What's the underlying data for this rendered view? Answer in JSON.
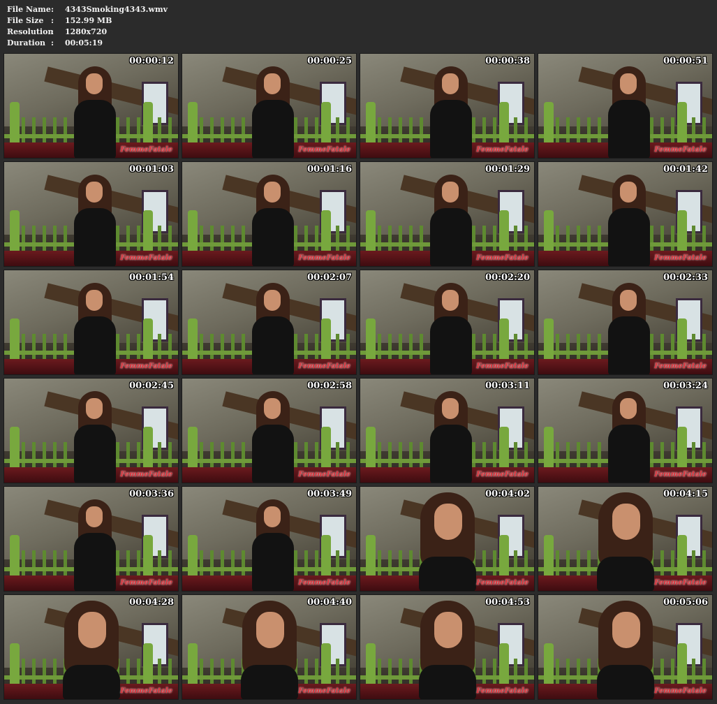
{
  "file_info": {
    "rows": [
      {
        "key": "File Name",
        "sep": ":",
        "value": "4343Smoking4343.wmv"
      },
      {
        "key": "File Size",
        "sep": ":",
        "value": "152.99 MB"
      },
      {
        "key": "Resolution",
        "sep": ":",
        "value": "1280x720"
      },
      {
        "key": "Duration",
        "sep": ":",
        "value": "00:05:19"
      }
    ]
  },
  "thumbnails": [
    {
      "timestamp": "00:00:12",
      "logo": "FemmeFatale",
      "style": "wide"
    },
    {
      "timestamp": "00:00:25",
      "logo": "FemmeFatale",
      "style": "wide"
    },
    {
      "timestamp": "00:00:38",
      "logo": "FemmeFatale",
      "style": "wide"
    },
    {
      "timestamp": "00:00:51",
      "logo": "FemmeFatale",
      "style": "wide"
    },
    {
      "timestamp": "00:01:03",
      "logo": "FemmeFatale",
      "style": "wide"
    },
    {
      "timestamp": "00:01:16",
      "logo": "FemmeFatale",
      "style": "wide"
    },
    {
      "timestamp": "00:01:29",
      "logo": "FemmeFatale",
      "style": "wide"
    },
    {
      "timestamp": "00:01:42",
      "logo": "FemmeFatale",
      "style": "wide"
    },
    {
      "timestamp": "00:01:54",
      "logo": "FemmeFatale",
      "style": "wide"
    },
    {
      "timestamp": "00:02:07",
      "logo": "FemmeFatale",
      "style": "wide"
    },
    {
      "timestamp": "00:02:20",
      "logo": "FemmeFatale",
      "style": "wide"
    },
    {
      "timestamp": "00:02:33",
      "logo": "FemmeFatale",
      "style": "wide"
    },
    {
      "timestamp": "00:02:45",
      "logo": "FemmeFatale",
      "style": "wide"
    },
    {
      "timestamp": "00:02:58",
      "logo": "FemmeFatale",
      "style": "wide"
    },
    {
      "timestamp": "00:03:11",
      "logo": "FemmeFatale",
      "style": "wide"
    },
    {
      "timestamp": "00:03:24",
      "logo": "FemmeFatale",
      "style": "wide"
    },
    {
      "timestamp": "00:03:36",
      "logo": "FemmeFatale",
      "style": "wide"
    },
    {
      "timestamp": "00:03:49",
      "logo": "FemmeFatale",
      "style": "wide"
    },
    {
      "timestamp": "00:04:02",
      "logo": "FemmeFatale",
      "style": "closeup"
    },
    {
      "timestamp": "00:04:15",
      "logo": "FemmeFatale",
      "style": "closeup"
    },
    {
      "timestamp": "00:04:28",
      "logo": "FemmeFatale",
      "style": "closeup"
    },
    {
      "timestamp": "00:04:40",
      "logo": "FemmeFatale",
      "style": "closeup"
    },
    {
      "timestamp": "00:04:53",
      "logo": "FemmeFatale",
      "style": "closeup"
    },
    {
      "timestamp": "00:05:06",
      "logo": "FemmeFatale",
      "style": "closeup"
    }
  ]
}
